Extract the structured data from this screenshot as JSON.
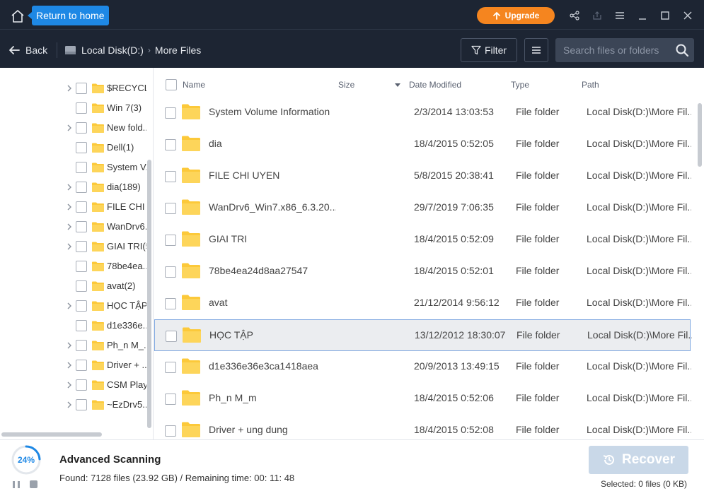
{
  "titlebar": {
    "tooltip": "Return to home",
    "upgrade_label": "Upgrade",
    "icons": [
      "home-icon",
      "share-icon",
      "export-icon",
      "hamburger-icon",
      "minimize-icon",
      "maximize-icon",
      "close-icon"
    ]
  },
  "nav": {
    "back_label": "Back",
    "breadcrumb": [
      "Local Disk(D:)",
      "More Files"
    ],
    "filter_label": "Filter",
    "search_placeholder": "Search files or folders"
  },
  "tree": {
    "items": [
      {
        "label": "$RECYCL...",
        "expandable": true
      },
      {
        "label": "Win 7(3)",
        "expandable": false
      },
      {
        "label": "New fold...",
        "expandable": true
      },
      {
        "label": "Dell(1)",
        "expandable": false
      },
      {
        "label": "System V...",
        "expandable": false
      },
      {
        "label": "dia(189)",
        "expandable": true
      },
      {
        "label": "FILE CHI ...",
        "expandable": true
      },
      {
        "label": "WanDrv6...",
        "expandable": true
      },
      {
        "label": "GIAI TRI(5",
        "expandable": true
      },
      {
        "label": "78be4ea...",
        "expandable": false
      },
      {
        "label": "avat(2)",
        "expandable": false
      },
      {
        "label": "HỌC TẬP...",
        "expandable": true
      },
      {
        "label": "d1e336e...",
        "expandable": false
      },
      {
        "label": "Ph_n M_...",
        "expandable": true
      },
      {
        "label": "Driver + ...",
        "expandable": true
      },
      {
        "label": "CSM Play...",
        "expandable": true
      },
      {
        "label": "~EzDrv5...",
        "expandable": true
      }
    ]
  },
  "list": {
    "columns": {
      "name": "Name",
      "size": "Size",
      "date": "Date Modified",
      "type": "Type",
      "path": "Path"
    },
    "rows": [
      {
        "name": "System Volume Information",
        "date": "2/3/2014 13:03:53",
        "type": "File folder",
        "path": "Local Disk(D:)\\More Fil..."
      },
      {
        "name": "dia",
        "date": "18/4/2015 0:52:05",
        "type": "File folder",
        "path": "Local Disk(D:)\\More Fil..."
      },
      {
        "name": "FILE CHI UYEN",
        "date": "5/8/2015 20:38:41",
        "type": "File folder",
        "path": "Local Disk(D:)\\More Fil..."
      },
      {
        "name": "WanDrv6_Win7.x86_6.3.20...",
        "date": "29/7/2019 7:06:35",
        "type": "File folder",
        "path": "Local Disk(D:)\\More Fil..."
      },
      {
        "name": "GIAI TRI",
        "date": "18/4/2015 0:52:09",
        "type": "File folder",
        "path": "Local Disk(D:)\\More Fil..."
      },
      {
        "name": "78be4ea24d8aa27547",
        "date": "18/4/2015 0:52:01",
        "type": "File folder",
        "path": "Local Disk(D:)\\More Fil..."
      },
      {
        "name": "avat",
        "date": "21/12/2014 9:56:12",
        "type": "File folder",
        "path": "Local Disk(D:)\\More Fil..."
      },
      {
        "name": "HỌC TẬP",
        "date": "13/12/2012 18:30:07",
        "type": "File folder",
        "path": "Local Disk(D:)\\More Fil...",
        "selected": true
      },
      {
        "name": "d1e336e36e3ca1418aea",
        "date": "20/9/2013 13:49:15",
        "type": "File folder",
        "path": "Local Disk(D:)\\More Fil..."
      },
      {
        "name": "Ph_n M_m",
        "date": "18/4/2015 0:52:06",
        "type": "File folder",
        "path": "Local Disk(D:)\\More Fil..."
      },
      {
        "name": "Driver + ung dung",
        "date": "18/4/2015 0:52:08",
        "type": "File folder",
        "path": "Local Disk(D:)\\More Fil..."
      }
    ]
  },
  "footer": {
    "progress_label": "24%",
    "progress": 0.24,
    "scan_title": "Advanced Scanning",
    "scan_status": "Found: 7128 files (23.92 GB) / Remaining time: 00: 11: 48",
    "recover_label": "Recover",
    "selected_info": "Selected: 0 files (0 KB)"
  },
  "colors": {
    "titlebar_bg": "#1d2533",
    "accent_blue": "#1e88e5",
    "upgrade_orange": "#f5851f",
    "folder_yellow": "#fcc93a",
    "recover_disabled": "#c9d8e8"
  }
}
